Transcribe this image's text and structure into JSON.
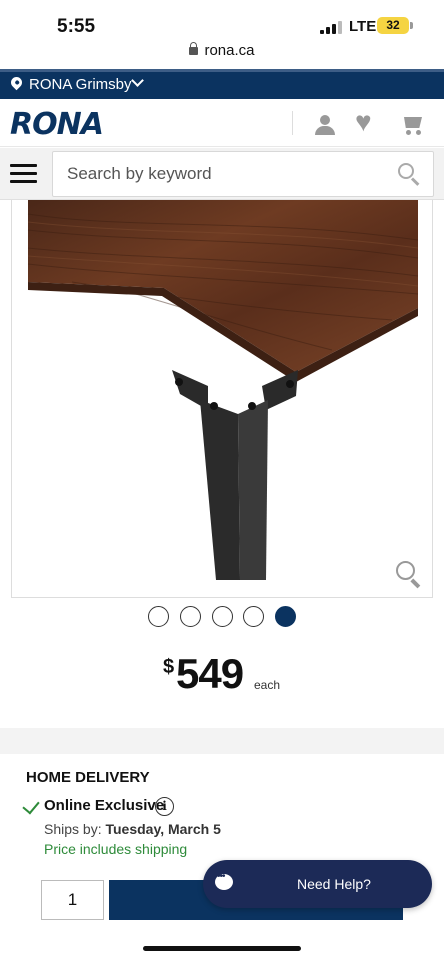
{
  "status_bar": {
    "time": "5:55",
    "network": "LTE",
    "battery": "32"
  },
  "browser": {
    "url": "rona.ca"
  },
  "store": {
    "name": "RONA Grimsby"
  },
  "header": {
    "logo": "RONA"
  },
  "search": {
    "placeholder": "Search by keyword"
  },
  "gallery": {
    "image_count": 5,
    "active_index": 4
  },
  "price": {
    "currency": "$",
    "amount": "549",
    "unit": "each"
  },
  "delivery": {
    "title": "HOME DELIVERY",
    "online_exclusive": "Online Exclusive",
    "ships_by_label": "Ships by:",
    "ships_by_date": "Tuesday, March 5",
    "shipping_note": "Price includes shipping",
    "quantity": "1"
  },
  "help": {
    "label": "Need Help?"
  },
  "colors": {
    "brand_navy": "#0b3360",
    "success_green": "#2e8b3a",
    "chat_bg": "#1c2a57"
  }
}
